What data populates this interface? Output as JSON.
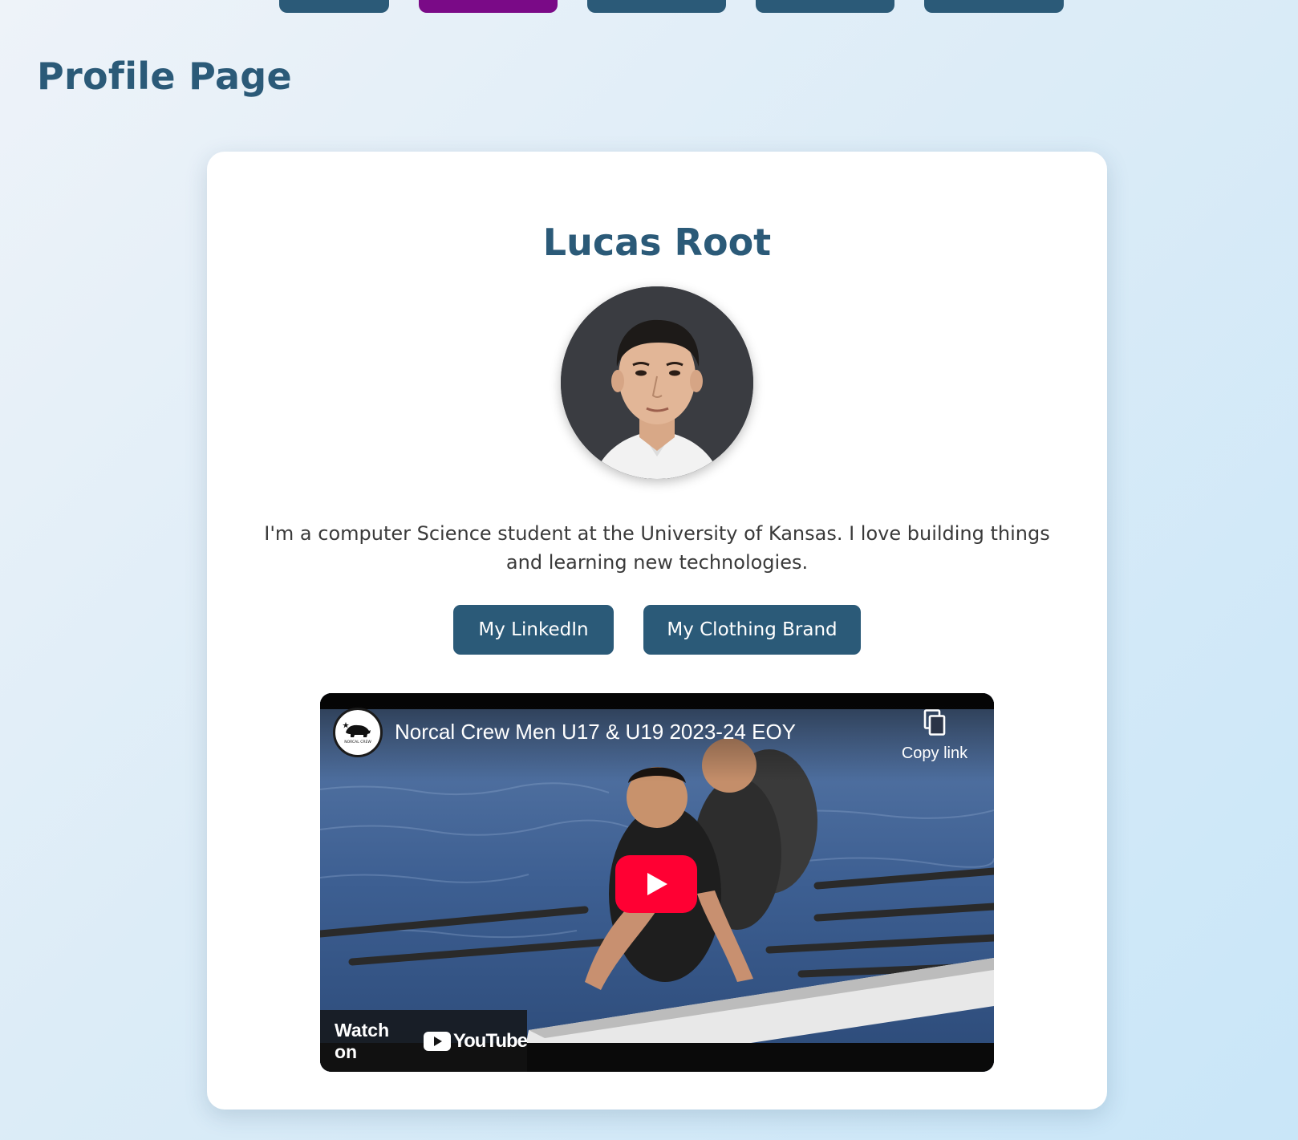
{
  "nav": {
    "tab_count": 5,
    "active_index": 1,
    "colors": {
      "default": "#2b5a78",
      "active": "#7a0a87"
    }
  },
  "page": {
    "title": "Profile Page"
  },
  "profile": {
    "name": "Lucas Root",
    "avatar_icon": "profile-photo",
    "bio": "I'm a computer Science student at the University of Kansas. I love building things and learning new technologies."
  },
  "links": {
    "linkedin_label": "My LinkedIn",
    "brand_label": "My Clothing Brand"
  },
  "video": {
    "title": "Norcal Crew Men U17 & U19 2023-24 EOY",
    "copy_link_label": "Copy link",
    "watch_on_label": "Watch on",
    "youtube_label": "YouTube",
    "channel_logo_icon": "norcal-crew-logo",
    "play_color": "#ff0033"
  },
  "colors": {
    "accent": "#2b5a78",
    "active_tab": "#7a0a87"
  }
}
